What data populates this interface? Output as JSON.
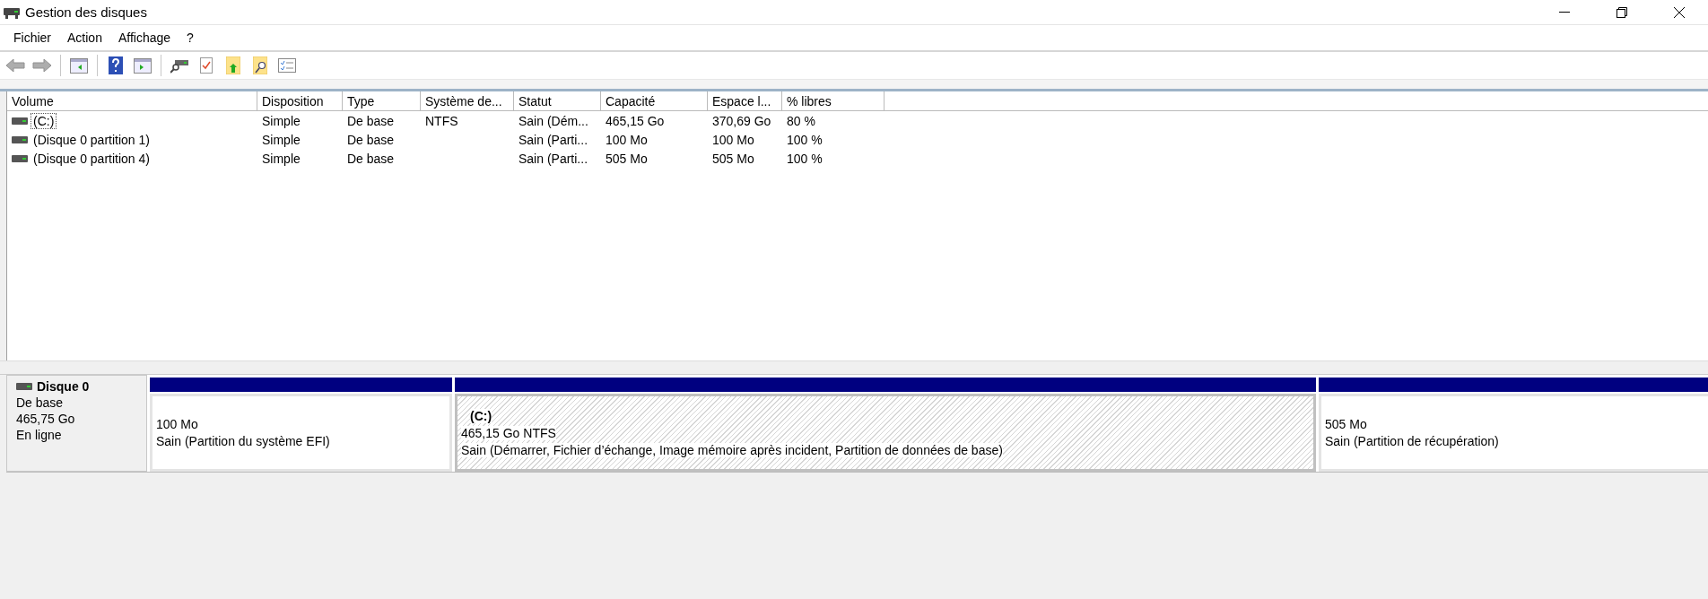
{
  "window": {
    "title": "Gestion des disques"
  },
  "menu": [
    "Fichier",
    "Action",
    "Affichage",
    "?"
  ],
  "toolbar": [
    {
      "kind": "back",
      "disabled": true
    },
    {
      "kind": "forward",
      "disabled": true
    },
    {
      "kind": "sep"
    },
    {
      "kind": "pane-left"
    },
    {
      "kind": "sep"
    },
    {
      "kind": "help"
    },
    {
      "kind": "pane-right"
    },
    {
      "kind": "sep"
    },
    {
      "kind": "disk-search"
    },
    {
      "kind": "checklist"
    },
    {
      "kind": "folder-up"
    },
    {
      "kind": "folder-search"
    },
    {
      "kind": "properties"
    }
  ],
  "table": {
    "columns": [
      "Volume",
      "Disposition",
      "Type",
      "Système de...",
      "Statut",
      "Capacité",
      "Espace l...",
      "% libres"
    ],
    "rows": [
      {
        "cells": [
          "(C:)",
          "Simple",
          "De base",
          "NTFS",
          "Sain (Dém...",
          "465,15 Go",
          "370,69 Go",
          "80 %"
        ],
        "focused": true
      },
      {
        "cells": [
          "(Disque 0 partition 1)",
          "Simple",
          "De base",
          null,
          "Sain (Parti...",
          "100 Mo",
          "100 Mo",
          "100 %"
        ],
        "focused": false
      },
      {
        "cells": [
          "(Disque 0 partition 4)",
          "Simple",
          "De base",
          null,
          "Sain (Parti...",
          "505 Mo",
          "505 Mo",
          "100 %"
        ],
        "focused": false
      }
    ]
  },
  "disk": {
    "name": "Disque 0",
    "type": "De base",
    "size": "465,75 Go",
    "status": "En ligne",
    "partitions": [
      {
        "size": "100 Mo",
        "status": "Sain (Partition du système EFI)",
        "selected": false
      },
      {
        "label": "(C:)",
        "size": "465,15 Go NTFS",
        "status": "Sain (Démarrer, Fichier d’échange, Image mémoire après incident, Partition de données de base)",
        "selected": true
      },
      {
        "size": "505 Mo",
        "status": "Sain (Partition de récupération)",
        "selected": false
      }
    ]
  }
}
